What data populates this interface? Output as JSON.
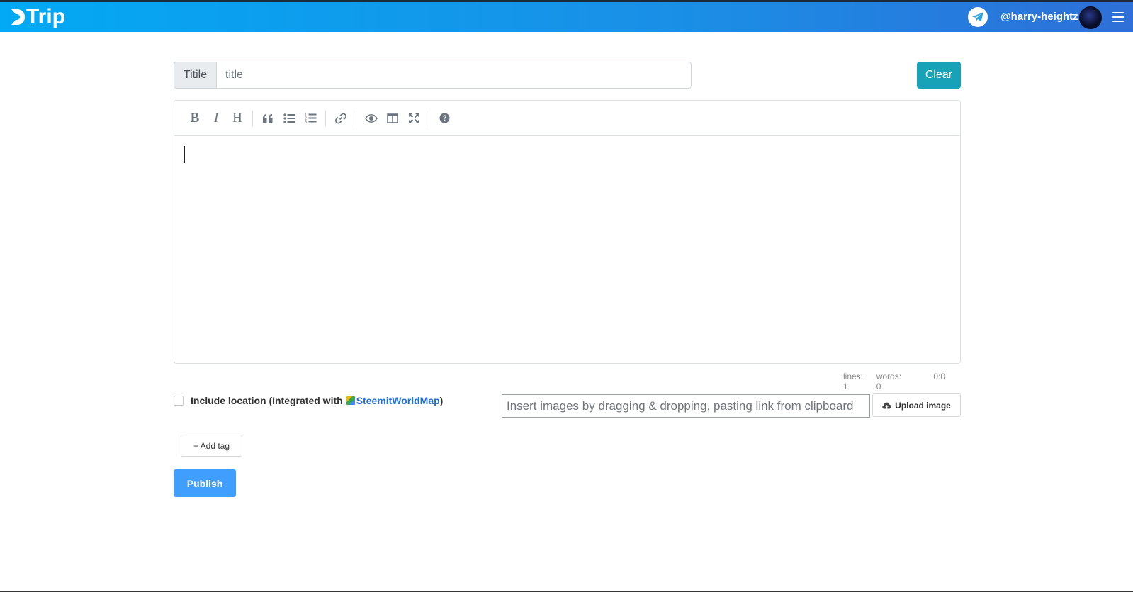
{
  "app": {
    "logo_text": "Trip",
    "username": "@harry-heightz"
  },
  "colors": {
    "navbar_start": "#03a9f4",
    "navbar_end": "#2e6fd8",
    "clear_button": "#17a2b8",
    "publish_button": "#409eff",
    "link": "#1e6fe0"
  },
  "icons": {
    "logo": "dtrip-d-logo",
    "telegram": "telegram-icon",
    "menu": "hamburger-icon",
    "upload": "cloud-upload-icon",
    "map": "map-icon"
  },
  "title_field": {
    "label": "Titile",
    "placeholder": "title",
    "value": ""
  },
  "clear_label": "Clear",
  "toolbar": {
    "bold": "B",
    "italic": "I",
    "heading": "H",
    "buttons": [
      "bold",
      "italic",
      "heading",
      "quote",
      "unordered-list",
      "ordered-list",
      "link",
      "preview",
      "side-by-side",
      "fullscreen",
      "guide"
    ]
  },
  "editor": {
    "content": ""
  },
  "status": {
    "lines": "lines: 1",
    "words": "words: 0",
    "cursor": "0:0"
  },
  "location": {
    "label": "Include location (Integrated with ",
    "link_text": "SteemitWorldMap",
    "suffix": ")",
    "checked": false
  },
  "image_input": {
    "placeholder": "Insert images by dragging & dropping, pasting link from clipboard"
  },
  "upload_label": "Upload image",
  "add_tag_label": "+ Add tag",
  "publish_label": "Publish"
}
